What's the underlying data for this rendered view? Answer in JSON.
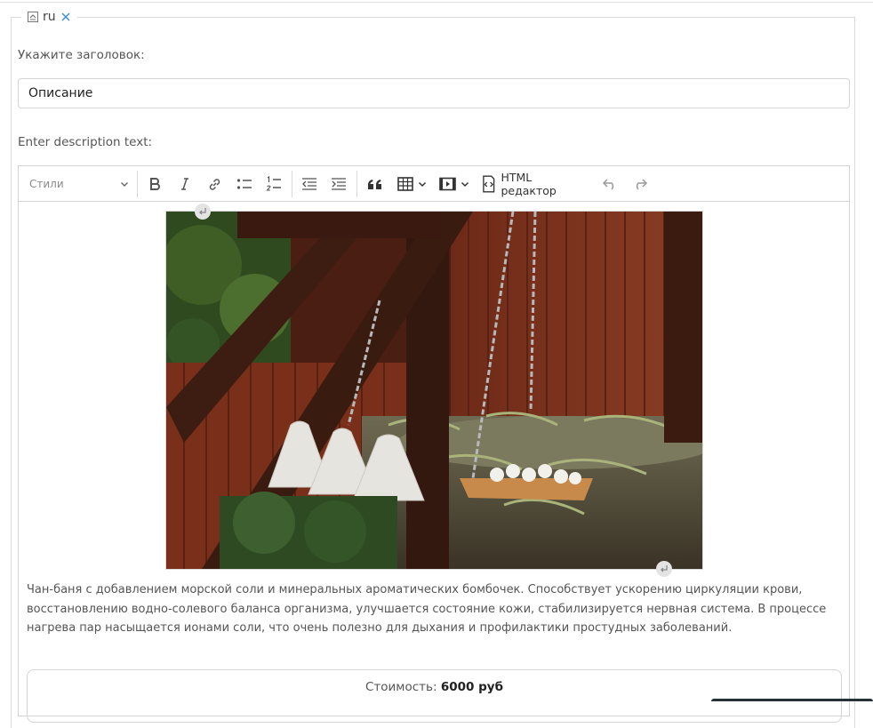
{
  "section": {
    "language": "ru"
  },
  "title_field": {
    "label": "Укажите заголовок:",
    "value": "Описание"
  },
  "description_field": {
    "label": "Enter description text:"
  },
  "toolbar": {
    "styles_label": "Стили",
    "html_editor_label": "HTML редактор",
    "icons": [
      "bold-icon",
      "italic-icon",
      "link-icon",
      "bulleted-list-icon",
      "numbered-list-icon",
      "outdent-icon",
      "indent-icon",
      "blockquote-icon",
      "table-icon",
      "media-icon",
      "html-source-icon",
      "undo-icon",
      "redo-icon"
    ]
  },
  "content": {
    "paragraph": "Чан-баня с добавлением морской соли и минеральных ароматических бомбочек. Способствует ускорению циркуляции крови, восстановлению водно-солевого баланса организма, улучшается состояние кожи, стабилизируется нервная система. В процессе нагрева пар насыщается ионами соли, что очень полезно для дыхания и профилактики простудных заболеваний.",
    "price_label": "Стоимость:",
    "price_value": "6000 руб"
  }
}
